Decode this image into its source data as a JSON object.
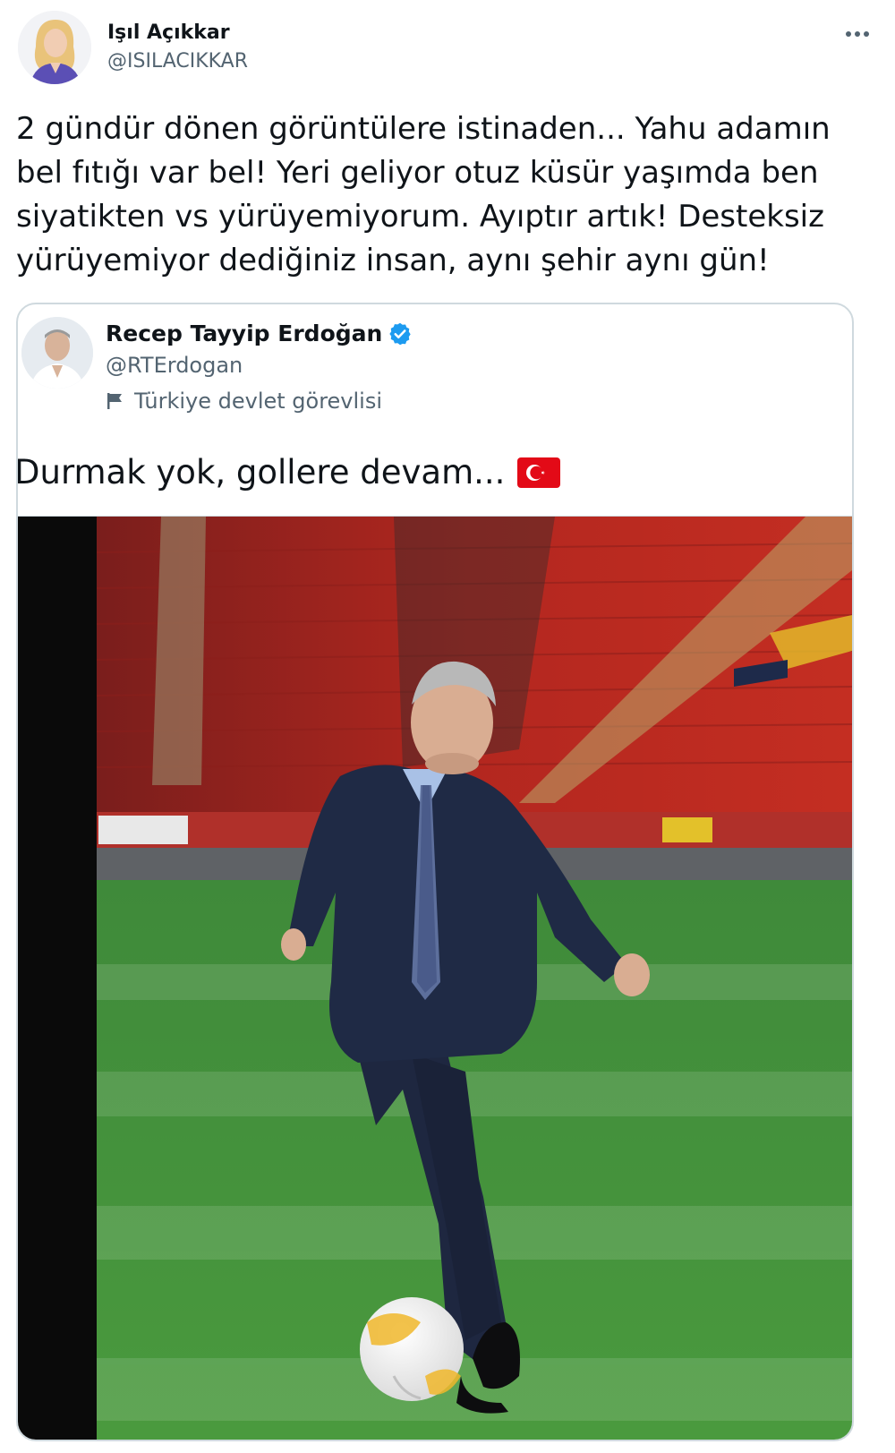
{
  "tweet": {
    "author_name": "Işıl Açıkkar",
    "author_handle": "@ISILACIKKAR",
    "more_icon": "more-horizontal-icon",
    "text": "2 gündür dönen görüntülere istinaden... Yahu adamın\nbel fıtığı var bel! Yeri geliyor otuz küsür yaşımda ben\nsiyatikten vs yürüyemiyorum. Ayıptır artık! Desteksiz\nyürüyemiyor dediğiniz insan, aynı şehir aynı gün!"
  },
  "quoted_tweet": {
    "author_name": "Recep Tayyip Erdoğan",
    "verified_icon": "verified-badge-icon",
    "author_handle": "@RTErdogan",
    "label_icon": "flag-icon",
    "label": "Türkiye devlet görevlisi",
    "text": "Durmak yok, gollere devam...",
    "emoji": "turkey-flag-icon"
  },
  "colors": {
    "text_primary": "#0f1419",
    "text_secondary": "#536471",
    "verified_blue": "#1d9bf0",
    "border": "#cfd9de",
    "flag_red": "#e30a17"
  }
}
